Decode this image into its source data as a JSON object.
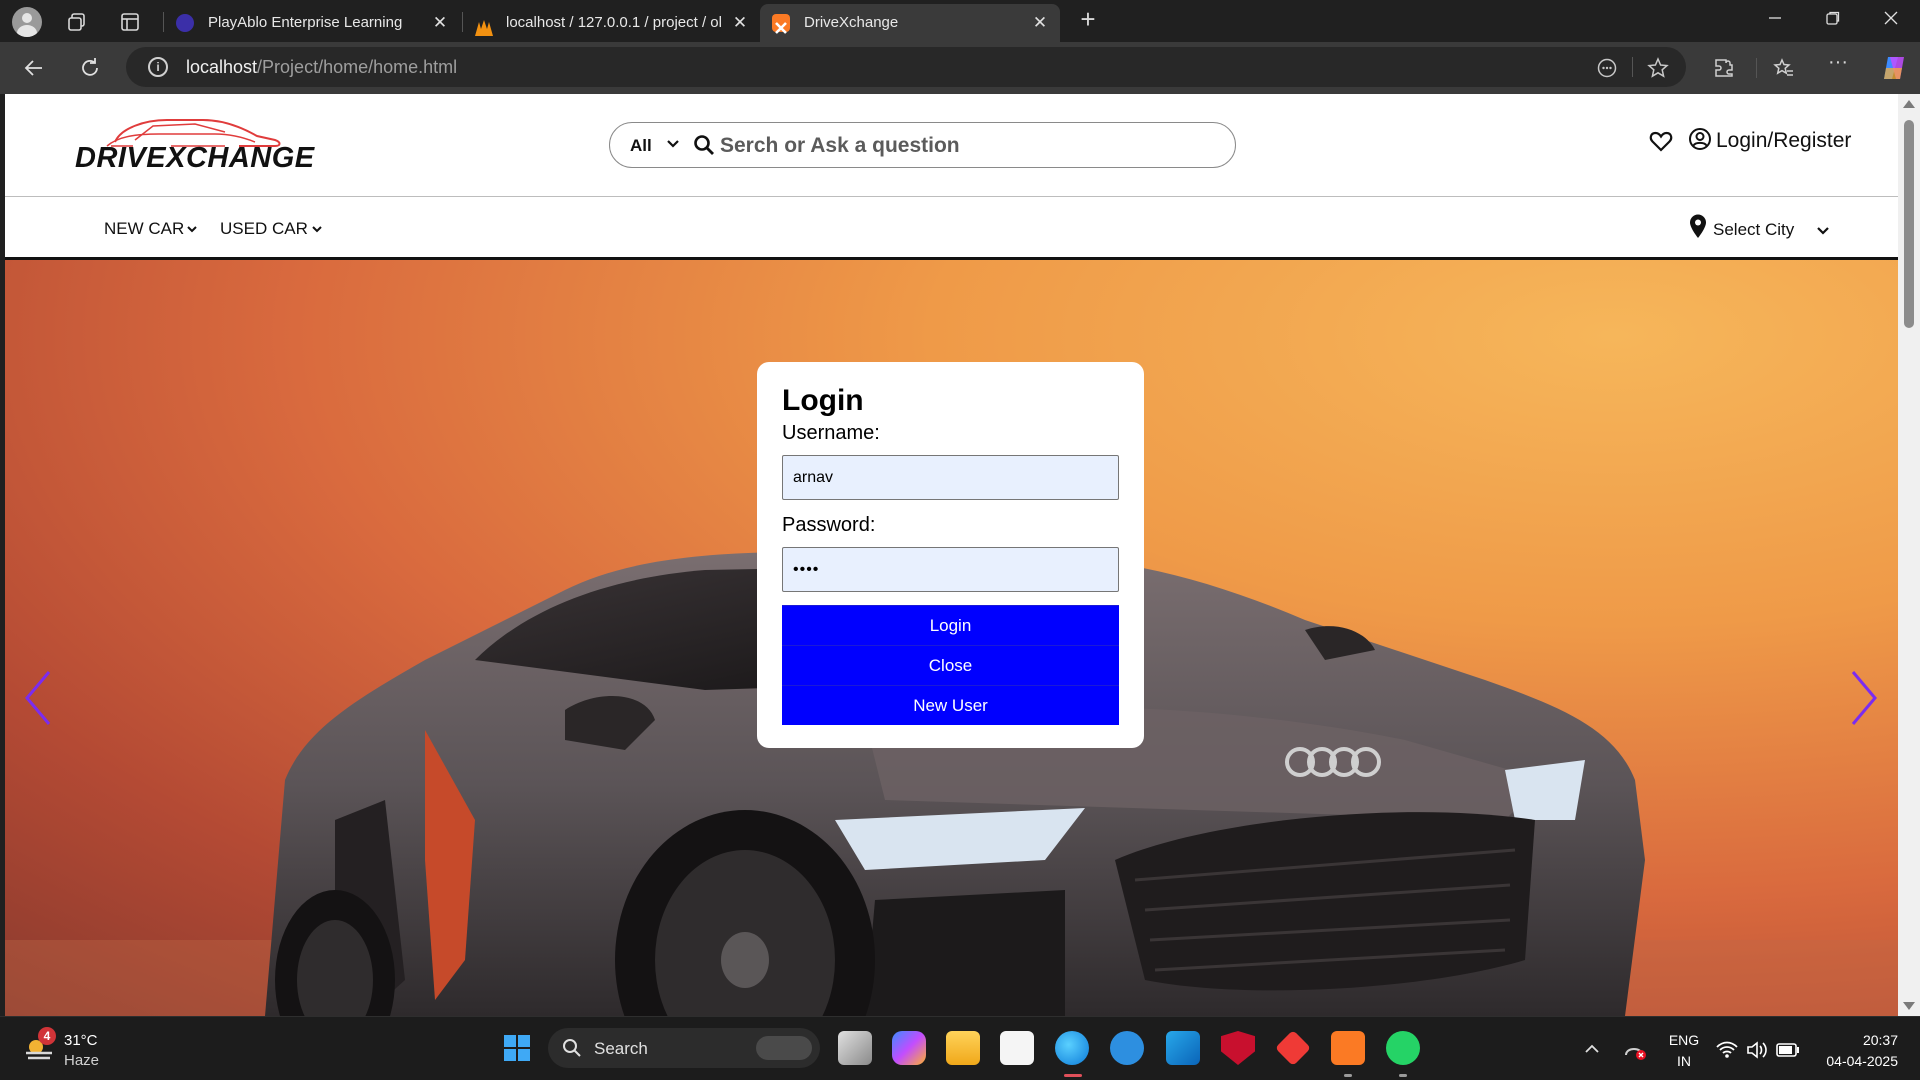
{
  "browser": {
    "tabs": [
      {
        "title": "PlayAblo Enterprise Learning",
        "active": false
      },
      {
        "title": "localhost / 127.0.0.1 / project / ol",
        "active": false
      },
      {
        "title": "DriveXchange",
        "active": true
      }
    ],
    "url_host": "localhost",
    "url_path": "/Project/home/home.html"
  },
  "header": {
    "logo_text": "DRIVEXCHANGE",
    "search": {
      "scope": "All",
      "placeholder": "Serch or Ask a question"
    },
    "account_label": "Login/Register"
  },
  "nav": {
    "items": [
      {
        "label": "NEW CAR"
      },
      {
        "label": "USED CAR"
      }
    ],
    "city_label": "Select City"
  },
  "login_modal": {
    "title": "Login",
    "username_label": "Username:",
    "username_value": "arnav",
    "password_label": "Password:",
    "password_value": "••••",
    "buttons": {
      "login": "Login",
      "close": "Close",
      "new_user": "New User"
    }
  },
  "taskbar": {
    "weather_badge": "4",
    "temperature": "31°C",
    "condition": "Haze",
    "search_label": "Search",
    "language": "ENG",
    "region": "IN",
    "time": "20:37",
    "date": "04-04-2025"
  },
  "colors": {
    "button_blue": "#0000ff",
    "field_bg": "#e8f0fe",
    "carousel_arrow": "#7b2cf0",
    "logo_red": "#e03c3c"
  }
}
